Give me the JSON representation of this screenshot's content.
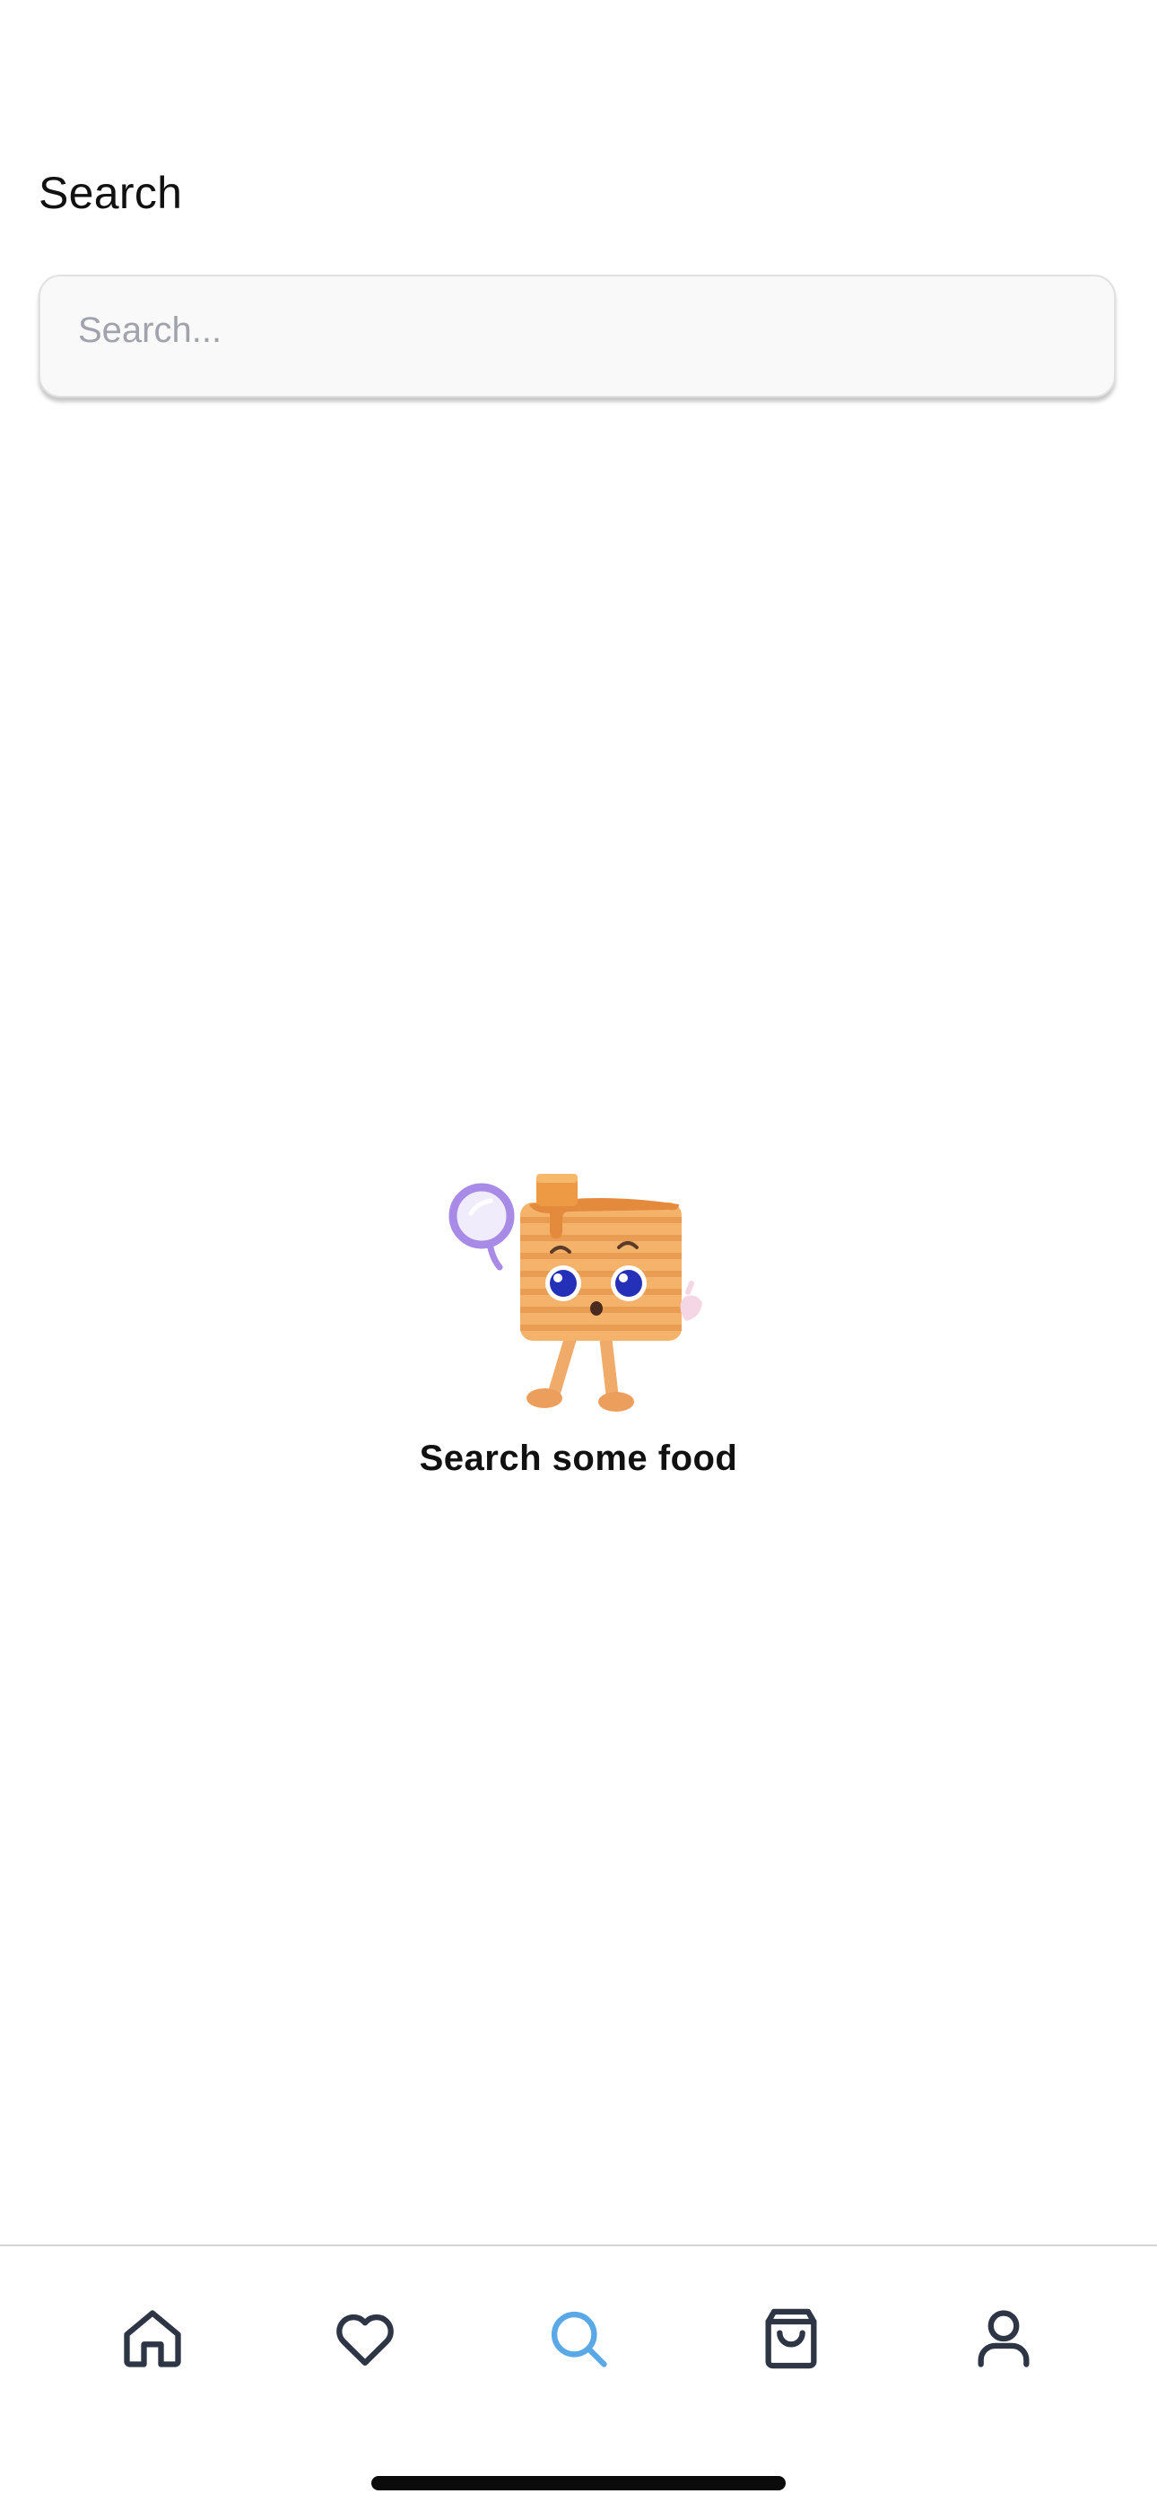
{
  "header": {
    "title": "Search"
  },
  "search": {
    "placeholder": "Search...",
    "value": ""
  },
  "empty_state": {
    "message": "Search some food",
    "illustration": "pancake-mascot-with-magnifier"
  },
  "tab_bar": {
    "active_tab": "search",
    "active_color": "#5aa9e6",
    "inactive_color": "#2e3646",
    "tabs": [
      {
        "id": "home",
        "icon": "home-icon"
      },
      {
        "id": "favorites",
        "icon": "heart-icon"
      },
      {
        "id": "search",
        "icon": "search-icon"
      },
      {
        "id": "cart",
        "icon": "shopping-bag-icon"
      },
      {
        "id": "profile",
        "icon": "user-icon"
      }
    ]
  },
  "colors": {
    "mascot_body": "#f4b26b",
    "mascot_stripes": "#e99d52",
    "mascot_eyes": "#2430b8",
    "magnifier": "#a88be6"
  }
}
